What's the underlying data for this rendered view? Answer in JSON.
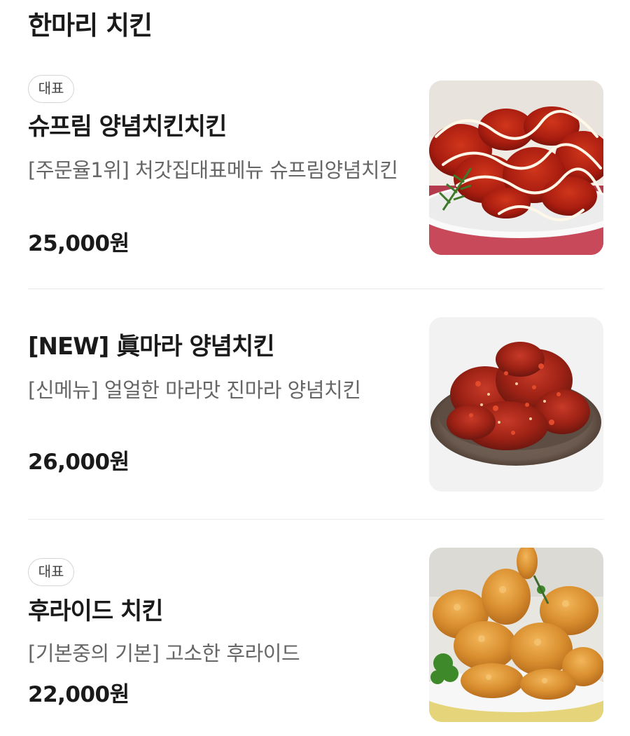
{
  "section": {
    "title": "한마리 치킨"
  },
  "items": [
    {
      "badge": "대표",
      "name": "슈프림 양념치킨치킨",
      "description": "[주문율1위] 처갓집대표메뉴 슈프림양념치킨",
      "price": "25,000원"
    },
    {
      "badge": "",
      "name": "[NEW] 眞마라 양념치킨",
      "description": "[신메뉴] 얼얼한 마라맛 진마라 양념치킨",
      "price": "26,000원"
    },
    {
      "badge": "대표",
      "name": "후라이드 치킨",
      "description": "[기본중의 기본] 고소한 후라이드",
      "price": "22,000원"
    }
  ]
}
